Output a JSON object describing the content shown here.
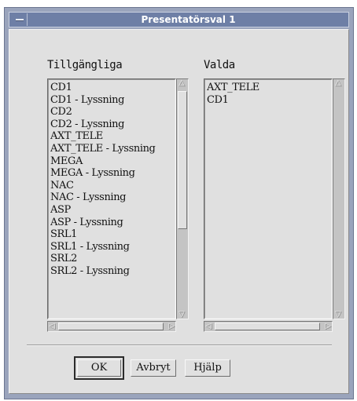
{
  "window": {
    "title": "Presentatörsval 1"
  },
  "available": {
    "label": "Tillgängliga",
    "items": [
      "CD1",
      "CD1 - Lyssning",
      "CD2",
      "CD2 - Lyssning",
      "AXT_TELE",
      "AXT_TELE - Lyssning",
      "MEGA",
      "MEGA - Lyssning",
      "NAC",
      "NAC - Lyssning",
      "ASP",
      "ASP - Lyssning",
      "SRL1",
      "SRL1 - Lyssning",
      "SRL2",
      "SRL2 - Lyssning"
    ]
  },
  "selected": {
    "label": "Valda",
    "items": [
      "AXT_TELE",
      "CD1"
    ]
  },
  "buttons": {
    "ok": "OK",
    "cancel": "Avbryt",
    "help": "Hjälp"
  },
  "icons": {
    "window_menu": "window-menu-icon",
    "scroll_up": "scroll-up-arrow-icon",
    "scroll_down": "scroll-down-arrow-icon",
    "scroll_left": "scroll-left-arrow-icon",
    "scroll_right": "scroll-right-arrow-icon"
  }
}
